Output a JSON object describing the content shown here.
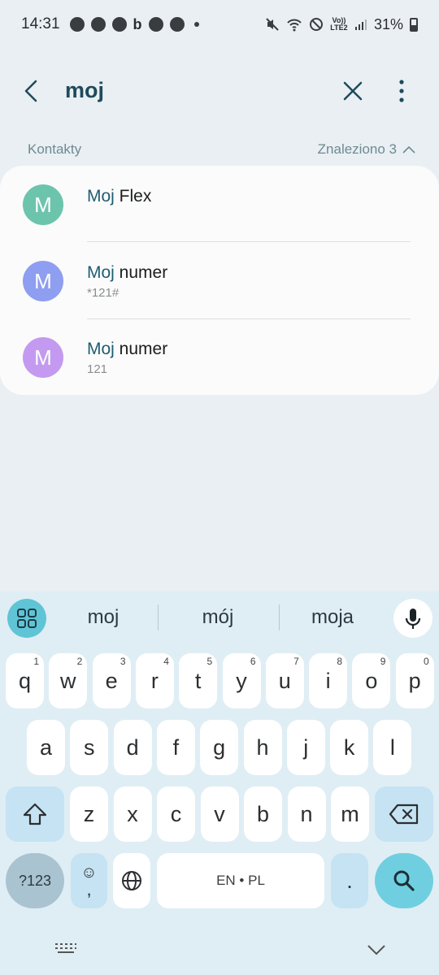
{
  "status_bar": {
    "time": "14:31",
    "volte_label": "Vo)) LTE2",
    "battery": "31%"
  },
  "search": {
    "query": "moj",
    "back_icon": "chevron-left-icon",
    "clear_icon": "close-icon",
    "more_icon": "more-vertical-icon"
  },
  "results": {
    "section_label": "Kontakty",
    "found_label": "Znaleziono 3",
    "contacts": [
      {
        "initial": "M",
        "highlight": "Moj",
        "rest": " Flex",
        "sub": "",
        "color": "#6cc4ac"
      },
      {
        "initial": "M",
        "highlight": "Moj",
        "rest": " numer",
        "sub": "*121#",
        "color": "#8e9ef0"
      },
      {
        "initial": "M",
        "highlight": "Moj",
        "rest": " numer",
        "sub": "121",
        "color": "#c49af0"
      }
    ]
  },
  "keyboard": {
    "suggestions": [
      "moj",
      "mój",
      "moja"
    ],
    "row1": [
      {
        "k": "q",
        "h": "1"
      },
      {
        "k": "w",
        "h": "2"
      },
      {
        "k": "e",
        "h": "3"
      },
      {
        "k": "r",
        "h": "4"
      },
      {
        "k": "t",
        "h": "5"
      },
      {
        "k": "y",
        "h": "6"
      },
      {
        "k": "u",
        "h": "7"
      },
      {
        "k": "i",
        "h": "8"
      },
      {
        "k": "o",
        "h": "9"
      },
      {
        "k": "p",
        "h": "0"
      }
    ],
    "row2": [
      "a",
      "s",
      "d",
      "f",
      "g",
      "h",
      "j",
      "k",
      "l"
    ],
    "row3": [
      "z",
      "x",
      "c",
      "v",
      "b",
      "n",
      "m"
    ],
    "symbols_label": "?123",
    "emoji_label": "☺",
    "comma_label": ",",
    "space_label": "EN • PL",
    "period_label": ".",
    "accent_color": "#6fcfe0"
  }
}
